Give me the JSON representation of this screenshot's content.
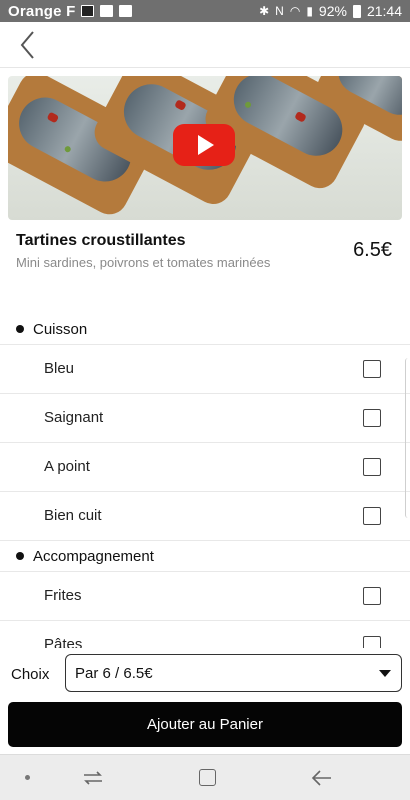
{
  "status_bar": {
    "carrier": "Orange F",
    "battery": "92%",
    "time": "21:44",
    "icons": [
      "bluetooth-icon",
      "nfc-icon",
      "wifi-icon",
      "signal-icon",
      "battery-icon"
    ]
  },
  "header": {
    "back_icon": "chevron-left-icon"
  },
  "product": {
    "title": "Tartines croustillantes",
    "description": "Mini sardines, poivrons et tomates marinées",
    "price": "6.5€",
    "video_icon": "youtube-play-icon"
  },
  "sections": [
    {
      "title": "Cuisson",
      "options": [
        {
          "label": "Bleu",
          "checked": false
        },
        {
          "label": "Saignant",
          "checked": false
        },
        {
          "label": "A point",
          "checked": false
        },
        {
          "label": "Bien cuit",
          "checked": false
        }
      ]
    },
    {
      "title": "Accompagnement",
      "options": [
        {
          "label": "Frites",
          "checked": false
        },
        {
          "label": "Pâtes",
          "checked": false
        }
      ]
    }
  ],
  "choice": {
    "label": "Choix",
    "selected": "Par 6 / 6.5€"
  },
  "add_to_cart": {
    "label": "Ajouter au Panier"
  },
  "nav_bar": {
    "icons": [
      "dot-icon",
      "recent-apps-icon",
      "home-icon",
      "back-arrow-icon"
    ]
  }
}
